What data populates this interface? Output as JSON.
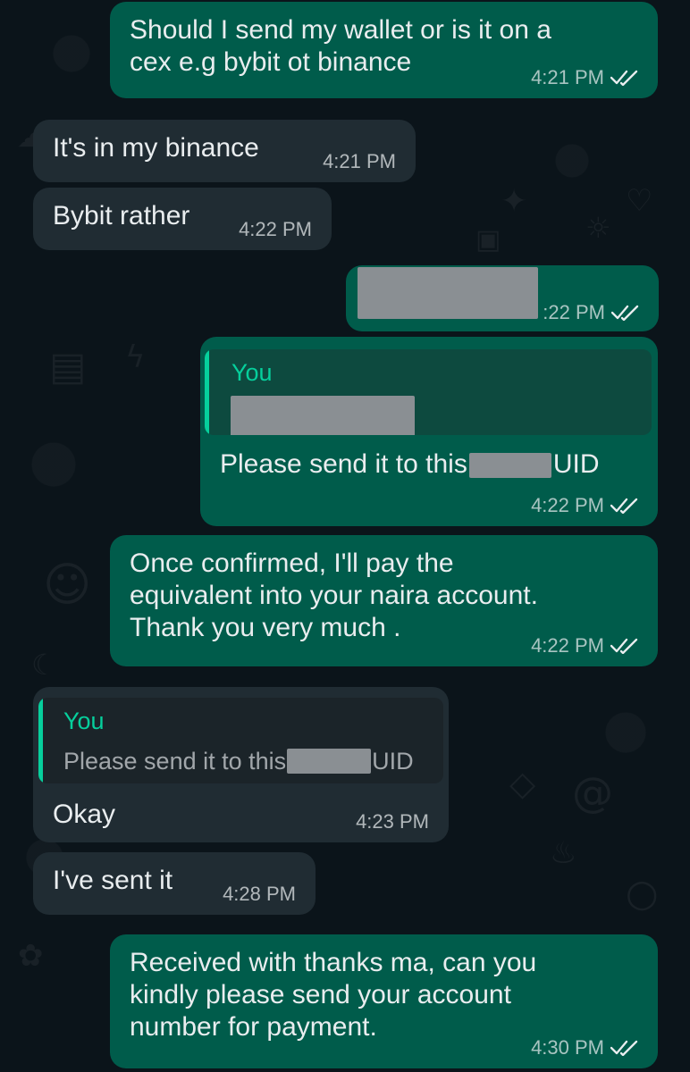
{
  "chat": {
    "messages": [
      {
        "direction": "outgoing",
        "text": "Should I send my wallet or is it on a\ncex e.g bybit ot binance",
        "time": "4:21 PM",
        "status": "read"
      },
      {
        "direction": "incoming",
        "text": "It's in my binance",
        "time": "4:21 PM"
      },
      {
        "direction": "incoming",
        "text": "Bybit rather",
        "time": "4:22 PM"
      },
      {
        "direction": "outgoing",
        "text": "",
        "time": ":22 PM",
        "status": "read"
      },
      {
        "direction": "outgoing",
        "reply_author": "You",
        "text_before": "Please send it to this",
        "text_after": "UID",
        "time": "4:22 PM",
        "status": "read"
      },
      {
        "direction": "outgoing",
        "text": "Once confirmed, I'll pay the\nequivalent into your naira account.\nThank you very much .",
        "time": "4:22 PM",
        "status": "read"
      },
      {
        "direction": "incoming",
        "reply_author": "You",
        "reply_before": "Please send it to this",
        "reply_after": "UID",
        "text": "Okay",
        "time": "4:23 PM"
      },
      {
        "direction": "incoming",
        "text": "I've sent it",
        "time": "4:28 PM"
      },
      {
        "direction": "outgoing",
        "text": "Received with thanks ma, can you\nkindly please send your account\nnumber for payment.",
        "time": "4:30 PM",
        "status": "read"
      }
    ]
  },
  "colors": {
    "background": "#0b141a",
    "incoming_bubble": "#202c33",
    "outgoing_bubble": "#005c4b",
    "reply_accent": "#06cf9c",
    "read_tick": "#e9edef"
  },
  "icons": {
    "read_receipt": "double-check-icon"
  }
}
